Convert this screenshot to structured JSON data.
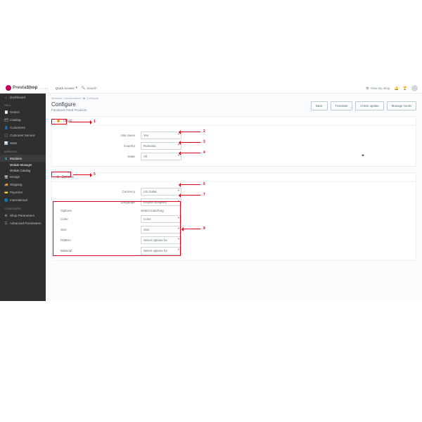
{
  "topbar": {
    "brand_a": "Presta",
    "brand_b": "Shop",
    "version": "1.7.4.2",
    "quick_access": "Quick Access",
    "search_placeholder": "Search",
    "view_shop": "View my shop"
  },
  "sidebar": {
    "dashboard": "Dashboard",
    "sec_sell": "SELL",
    "orders": "Orders",
    "catalog": "Catalog",
    "customers": "Customers",
    "customer_service": "Customer Service",
    "stats": "Stats",
    "sec_improve": "IMPROVE",
    "modules": "Modules",
    "modules_sub1": "Module Manager",
    "modules_sub2": "Module Catalog",
    "design": "Design",
    "shipping": "Shipping",
    "payment": "Payment",
    "international": "International",
    "sec_configure": "CONFIGURE",
    "shop_params": "Shop Parameters",
    "adv_params": "Advanced Parameters"
  },
  "breadcrumb": "Modules  /  facebookfeed  /  ▶ Configure",
  "page": {
    "title": "Configure",
    "subtitle": "Facebook Feed Products",
    "btn_back": "Back",
    "btn_translate": "Translate",
    "btn_check": "Check update",
    "btn_hooks": "Manage hooks"
  },
  "panels": {
    "taxes_title": "Taxes",
    "options_title": "Options"
  },
  "fields": {
    "use_taxes": "Use taxes",
    "use_taxes_val": "Yes",
    "country": "Country",
    "country_val": "Romania",
    "state": "State",
    "state_val": "All",
    "currency": "Currency",
    "currency_val": "US Dollar",
    "language": "Language",
    "language_val": "English (English)",
    "options_col": "Options",
    "matching_col": "Select matching",
    "color": "Color",
    "color_val": "Color",
    "size": "Size",
    "size_val": "Size",
    "pattern": "Pattern",
    "pattern_val": "Select options for",
    "material": "Material",
    "material_val": "Select options for"
  },
  "annotations": {
    "n1": "1",
    "n2": "2",
    "n3": "3",
    "n4": "4",
    "n5": "5",
    "n6": "6",
    "n7": "7",
    "n8": "8"
  }
}
